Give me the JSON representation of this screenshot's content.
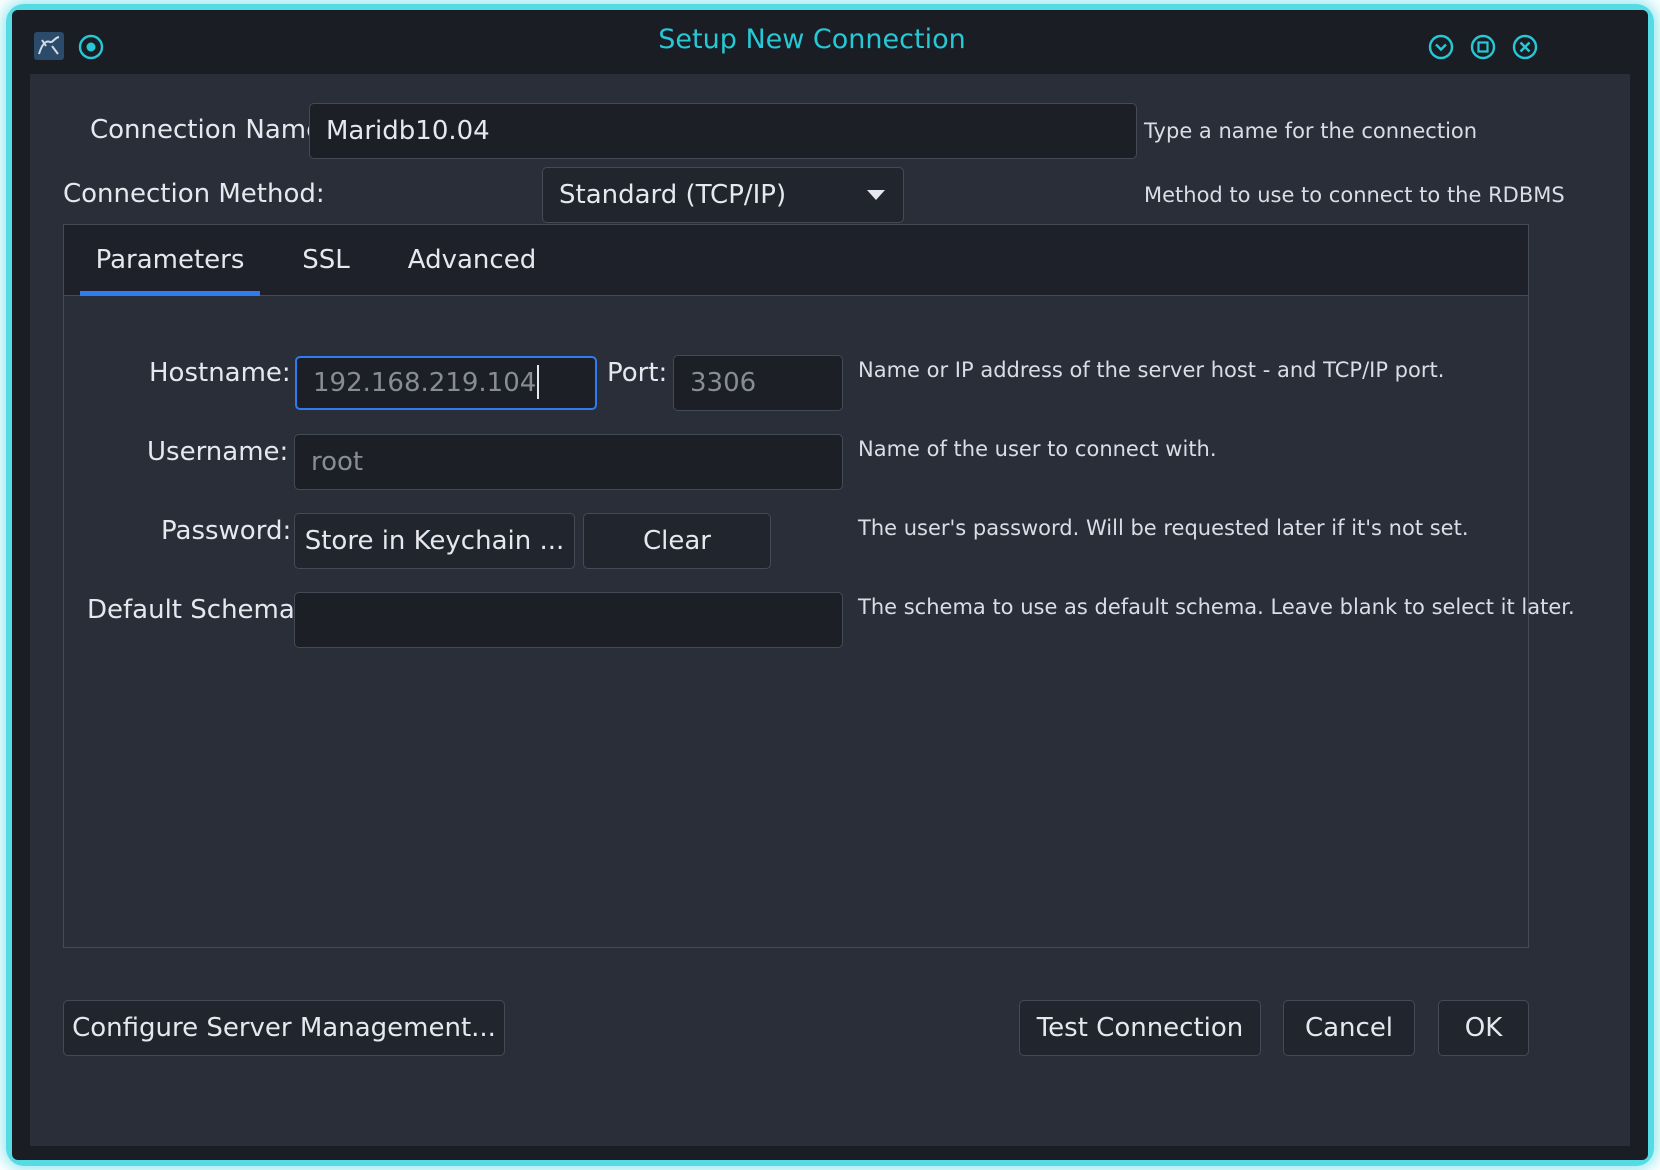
{
  "window": {
    "title": "Setup New Connection",
    "title_color": "#27c8d6",
    "icons": [
      "mysql-workbench-icon",
      "pin-icon",
      "minimize-icon",
      "maximize-icon",
      "close-icon"
    ]
  },
  "connection_name": {
    "label": "Connection Name:",
    "value": "Maridb10.04",
    "hint": "Type a name for the connection"
  },
  "connection_method": {
    "label": "Connection Method:",
    "selected": "Standard (TCP/IP)",
    "hint": "Method to use to connect to the RDBMS"
  },
  "tabs": [
    {
      "label": "Parameters",
      "active": true
    },
    {
      "label": "SSL",
      "active": false
    },
    {
      "label": "Advanced",
      "active": false
    }
  ],
  "parameters": {
    "hostname": {
      "label": "Hostname:",
      "value": "192.168.219.104"
    },
    "port": {
      "label": "Port:",
      "value": "3306"
    },
    "host_hint": "Name or IP address of the server host - and TCP/IP port.",
    "username": {
      "label": "Username:",
      "value": "root",
      "hint": "Name of the user to connect with."
    },
    "password": {
      "label": "Password:",
      "store_button": "Store in Keychain ...",
      "clear_button": "Clear",
      "hint": "The user's password. Will be requested later if it's not set."
    },
    "default_schema": {
      "label": "Default Schema:",
      "value": "",
      "hint": "The schema to use as default schema. Leave blank to select it later."
    }
  },
  "footer": {
    "configure_button": "Configure Server Management...",
    "test_button": "Test Connection",
    "cancel_button": "Cancel",
    "ok_button": "OK"
  },
  "colors": {
    "accent": "#2f7cf0",
    "background": "#2a2e39",
    "field": "#1c1f26"
  }
}
